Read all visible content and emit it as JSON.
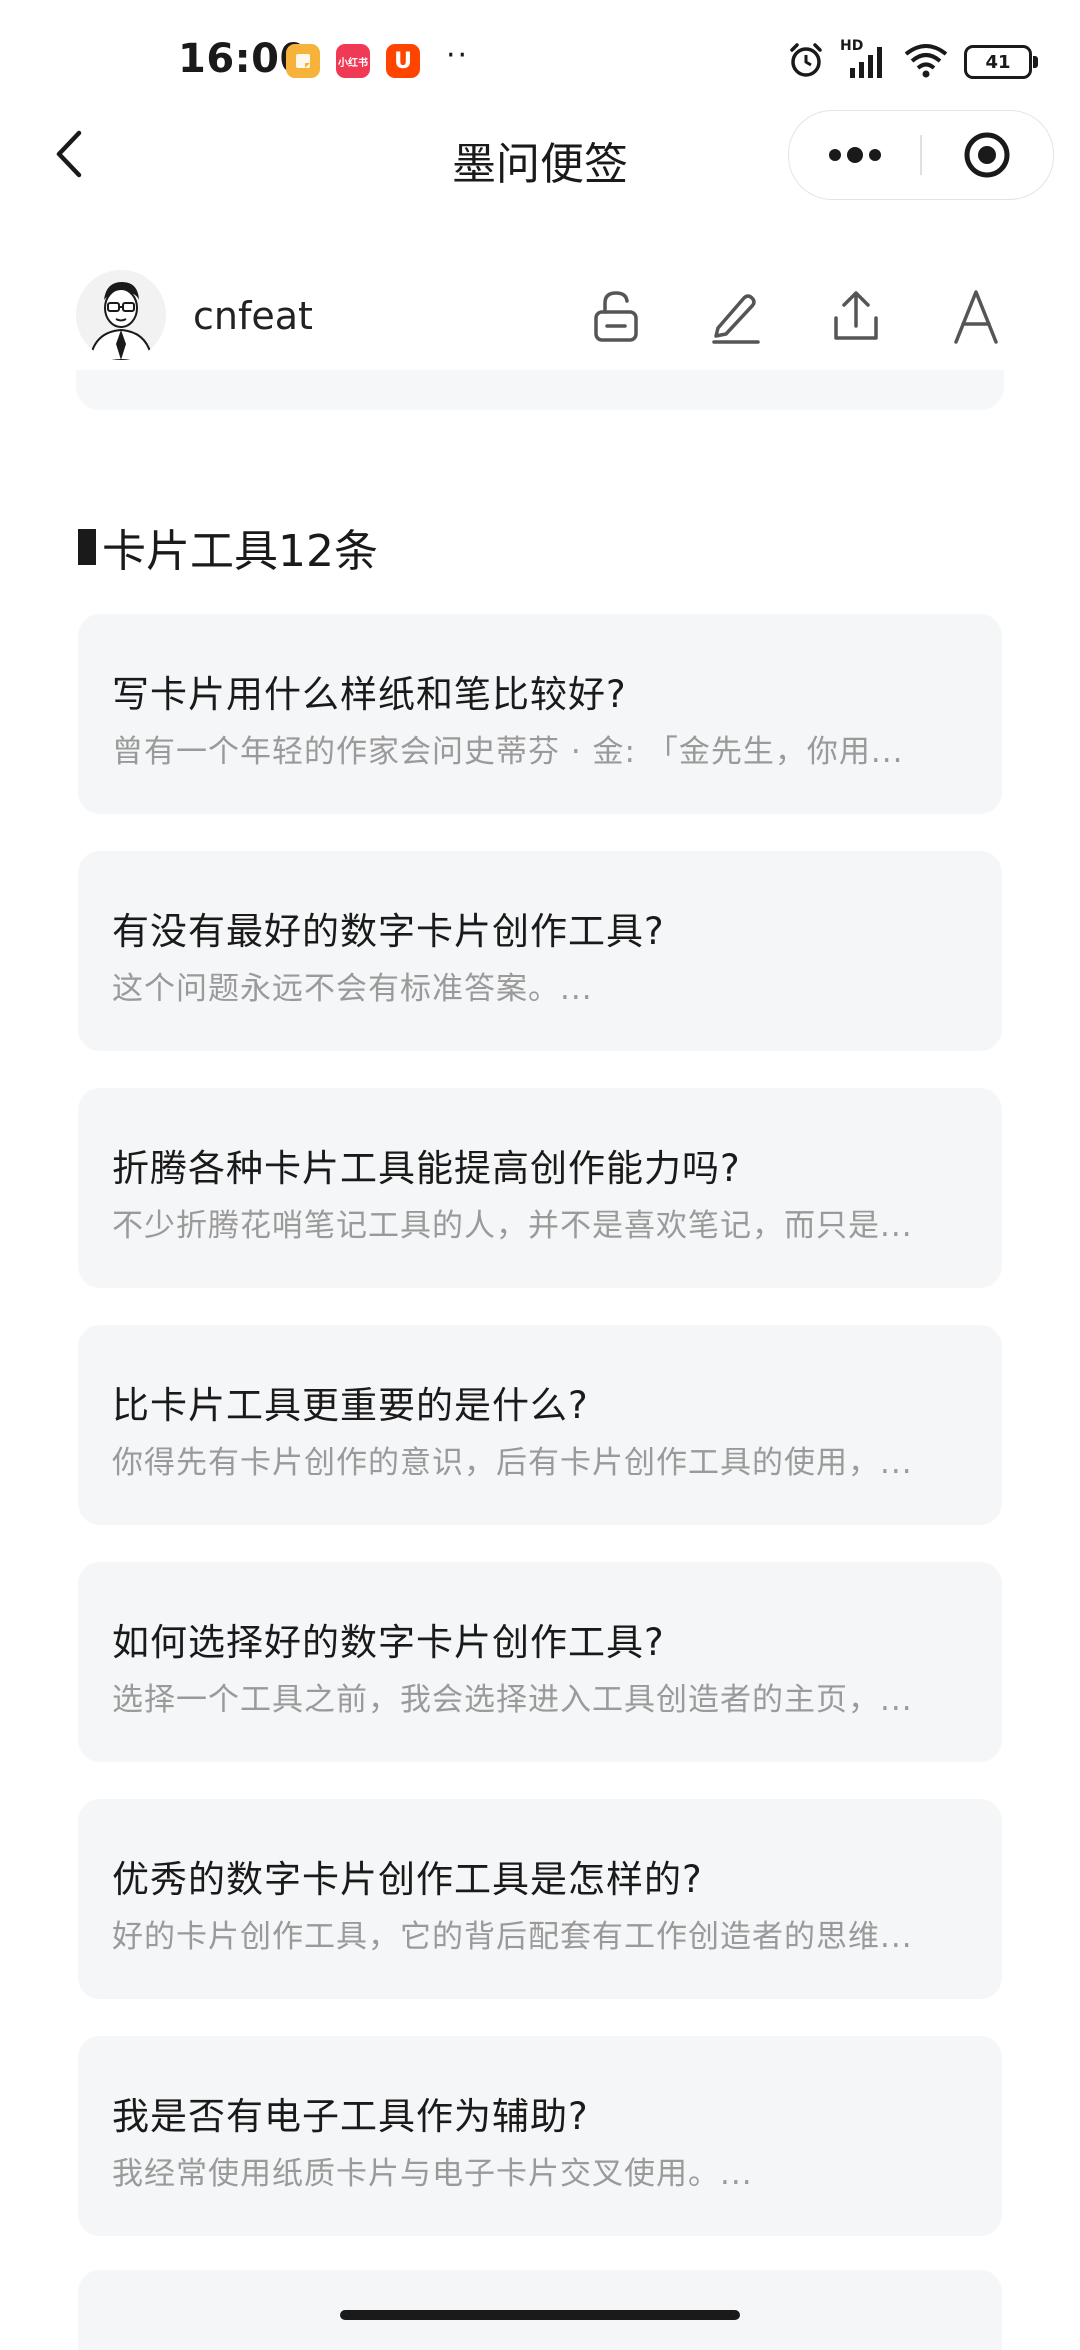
{
  "status_bar": {
    "time": "16:00",
    "app_icons": [
      "notes-app-icon",
      "xiaohongshu-app-icon",
      "taobao-app-icon"
    ],
    "xhs_label": "小红书",
    "tb_label": "U",
    "dots": "··",
    "signal_label": "HD",
    "battery": "41"
  },
  "nav": {
    "title": "墨问便签"
  },
  "user": {
    "name": "cnfeat"
  },
  "section": {
    "title": "卡片工具12条"
  },
  "cards": [
    {
      "title": "写卡片用什么样纸和笔比较好?",
      "desc": "曾有一个年轻的作家会问史蒂芬 · 金: 「金先生，你用..."
    },
    {
      "title": "有没有最好的数字卡片创作工具?",
      "desc": "这个问题永远不会有标准答案。..."
    },
    {
      "title": "折腾各种卡片工具能提高创作能力吗?",
      "desc": "不少折腾花哨笔记工具的人，并不是喜欢笔记，而只是..."
    },
    {
      "title": "比卡片工具更重要的是什么?",
      "desc": "你得先有卡片创作的意识，后有卡片创作工具的使用，..."
    },
    {
      "title": "如何选择好的数字卡片创作工具?",
      "desc": "选择一个工具之前，我会选择进入工具创造者的主页，..."
    },
    {
      "title": "优秀的数字卡片创作工具是怎样的?",
      "desc": "好的卡片创作工具，它的背后配套有工作创造者的思维..."
    },
    {
      "title": "我是否有电子工具作为辅助?",
      "desc": "我经常使用纸质卡片与电子卡片交叉使用。..."
    }
  ],
  "colors": {
    "card_bg": "#f5f6f7",
    "title_text": "#1a1a1a",
    "desc_text": "#9a9a9a"
  }
}
